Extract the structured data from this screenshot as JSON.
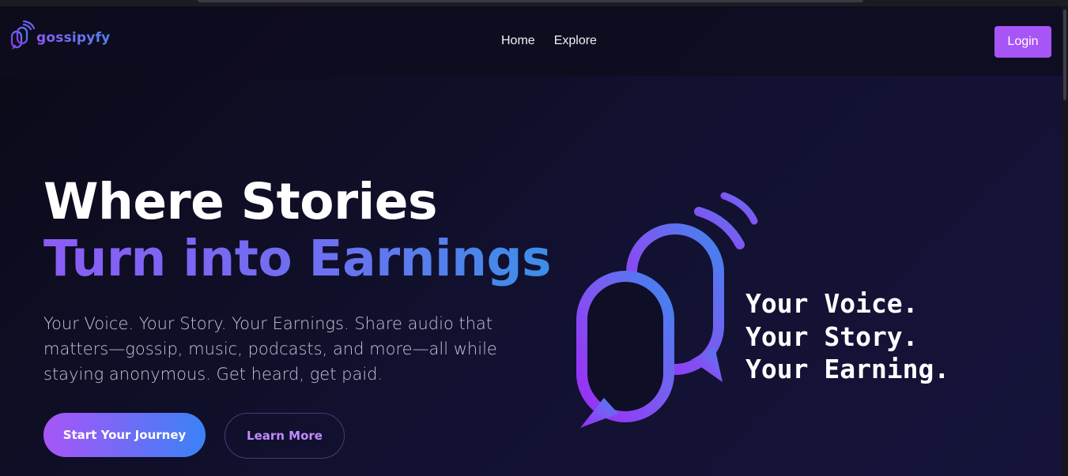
{
  "brand": {
    "name": "gossipyfy",
    "logo_icon": "microphone-chat-bubble-icon"
  },
  "nav": {
    "items": [
      {
        "label": "Home"
      },
      {
        "label": "Explore"
      }
    ],
    "login_label": "Login"
  },
  "hero": {
    "title_line1": "Where Stories",
    "title_line2": "Turn into Earnings",
    "subtitle": "Your Voice. Your Story. Your Earnings. Share audio that matters—gossip, music, podcasts, and more—all while staying anonymous. Get heard, get paid.",
    "primary_cta": "Start Your Journey",
    "secondary_cta": "Learn More"
  },
  "illustration": {
    "icon": "dual-microphone-chat-bubble-icon",
    "tagline": [
      "Your Voice.",
      "Your Story.",
      "Your Earning."
    ]
  },
  "colors": {
    "accent_purple": "#a855f7",
    "accent_blue": "#3b82f6",
    "background": "#0c0b1c",
    "secondary_text": "#c4c3d4"
  }
}
